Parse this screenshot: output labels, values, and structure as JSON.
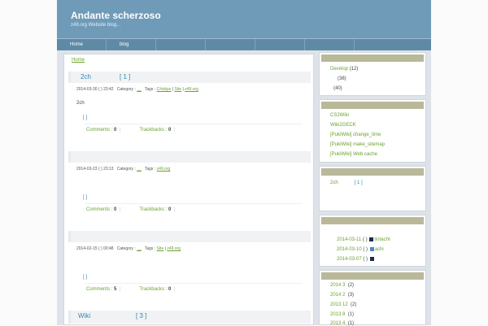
{
  "site": {
    "title": "Andante scherzoso",
    "description": "z49.org  Website    blog..."
  },
  "nav": [
    {
      "label": "Home"
    },
    {
      "label": "blog"
    }
  ],
  "breadcrumb": "Home",
  "posts": [
    {
      "title": "2ch",
      "count": "[  1  ]",
      "datetime": "2014-03-30 ( ) 23:42",
      "category_label": "Category :",
      "category": "__",
      "tags_label": "Tags :",
      "tags": [
        "C#skips",
        "Site",
        "z49.org"
      ],
      "body": "2ch",
      "brackets": "[     ]",
      "comments_label": "Comments :",
      "comments": "0",
      "trackbacks_label": "Trackbacks :",
      "trackbacks": "0"
    },
    {
      "title": "",
      "count": "",
      "datetime": "2014-03-23 ( ) 23:13",
      "category_label": "Category :",
      "category": "__",
      "tags_label": "Tags :",
      "tags": [
        "z49.org"
      ],
      "body": "",
      "brackets": "[     ]",
      "comments_label": "Comments :",
      "comments": "0",
      "trackbacks_label": "Trackbacks :",
      "trackbacks": "0"
    },
    {
      "title": "",
      "count": "",
      "datetime": "2014-02-15 ( ) 00:48",
      "category_label": "Category :",
      "category": "__",
      "tags_label": "Tags :",
      "tags": [
        "Site",
        "z49.org"
      ],
      "body": "",
      "brackets": "[     ]",
      "comments_label": "Comments :",
      "comments": "5",
      "trackbacks_label": "Trackbacks :",
      "trackbacks": "0"
    },
    {
      "title": "Wiki",
      "count": "[  3  ]"
    }
  ],
  "sidebar": {
    "categories": [
      {
        "label": "Develop",
        "count": "(12)"
      },
      {
        "label": "",
        "count": "(38)"
      },
      {
        "label": "",
        "count": "(40)"
      }
    ],
    "recent": [
      "CS2Wiki",
      "Wiki2GECK",
      "[PukiWiki] change_time",
      "[PukiWiki] make_sitemap",
      "[PukiWiki] Web cache"
    ],
    "popular": {
      "label": "2ch",
      "count": "[  1  ]"
    },
    "comments": [
      {
        "date": "2014-03-11",
        "bracket": "( )",
        "name": "tintacht"
      },
      {
        "date": "2014-03-10",
        "bracket": "( )",
        "name": "achi"
      },
      {
        "date": "2014-03-07",
        "bracket": "( )",
        "name": ""
      }
    ],
    "archives": [
      {
        "label": "2014  3",
        "count": "(2)"
      },
      {
        "label": "2014  2",
        "count": "(3)"
      },
      {
        "label": "2013  12",
        "count": "(2)"
      },
      {
        "label": "2013  8",
        "count": "(1)"
      },
      {
        "label": "2013  4",
        "count": "(1)"
      }
    ]
  }
}
